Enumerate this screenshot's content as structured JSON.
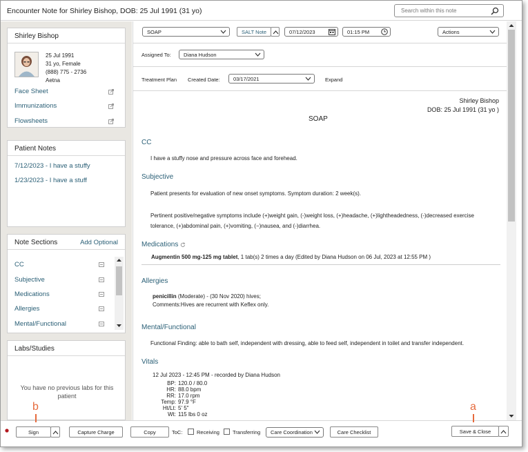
{
  "window": {
    "title": "Encounter Note for Shirley Bishop, DOB: 25 Jul 1991 (31 yo)"
  },
  "search": {
    "placeholder": "Search within this note"
  },
  "patient": {
    "name": "Shirley Bishop",
    "dob": "25 Jul 1991",
    "age_sex": "31 yo, Female",
    "phone": "(888) 775 - 2736",
    "insurance": "Aetna",
    "links": [
      "Face Sheet",
      "Immunizations",
      "Flowsheets"
    ]
  },
  "patient_notes": {
    "title": "Patient Notes",
    "items": [
      "7/12/2023 - I have a stuffy",
      "1/23/2023 - I have a stuff"
    ]
  },
  "note_sections": {
    "title": "Note Sections",
    "add_label": "Add Optional",
    "items": [
      "CC",
      "Subjective",
      "Medications",
      "Allergies",
      "Mental/Functional"
    ]
  },
  "labs": {
    "title": "Labs/Studies",
    "empty_text": "You have no previous labs for this patient"
  },
  "toolbar": {
    "template": "SOAP",
    "salt_note": "SALT Note",
    "date": "07/12/2023",
    "time": "01:15 PM",
    "actions": "Actions"
  },
  "assigned": {
    "label": "Assigned To:",
    "value": "Diana Hudson"
  },
  "treatment": {
    "label": "Treatment Plan",
    "created_label": "Created Date:",
    "created_value": "03/17/2021",
    "expand": "Expand"
  },
  "document": {
    "patient_name": "Shirley Bishop",
    "patient_dob": "DOB: 25 Jul 1991 (31 yo )",
    "heading": "SOAP",
    "cc_title": "CC",
    "cc_text": "I have a stuffy nose and pressure across face and forehead.",
    "subjective_title": "Subjective",
    "subjective_text1": "Patient presents for evaluation of new onset symptoms. Symptom duration: 2 week(s).",
    "subjective_text2": "Pertinent positive/negative symptoms include (+)weight gain, (-)weight loss, (+)headache, (+)lightheadedness, (-)decreased exercise",
    "subjective_text3": "tolerance, (+)abdominal pain, (+)vomiting, (−)nausea, and (-)diarrhea.",
    "medications_title": "Medications",
    "medication_name": "Augmentin 500 mg-125 mg tablet",
    "medication_detail": ", 1 tab(s) 2 times a day (Edited by Diana Hudson on 06 Jul, 2023 at 12:55 PM )",
    "allergies_title": "Allergies",
    "allergy_name": "penicillin",
    "allergy_detail": " (Moderate) - (30 Nov 2020) hives;",
    "allergy_comments": "Comments:Hives are recurrent with Keflex only.",
    "mental_title": "Mental/Functional",
    "mental_text": "Functional Finding: able to bath self, independent with dressing, able to feed self, independent in toilet and transfer independent.",
    "vitals_title": "Vitals",
    "vitals_header": "12 Jul 2023 - 12:45 PM - recorded by Diana Hudson",
    "vitals": [
      {
        "label": "BP:",
        "value": "120.0 / 80.0"
      },
      {
        "label": "HR:",
        "value": "88.0 bpm"
      },
      {
        "label": "RR:",
        "value": "17.0 rpm"
      },
      {
        "label": "Temp:",
        "value": "97.9 °F"
      },
      {
        "label": "Ht/Lt:",
        "value": "5' 5\""
      },
      {
        "label": "Wt:",
        "value": "115 lbs 0 oz"
      }
    ]
  },
  "bottom": {
    "sign": "Sign",
    "capture_charge": "Capture Charge",
    "copy": "Copy",
    "toc_label": "ToC:",
    "receiving": "Receiving",
    "transferring": "Transferring",
    "care_coordination": "Care Coordination",
    "care_checklist": "Care Checklist",
    "save_close": "Save & Close"
  },
  "callouts": {
    "a": "a",
    "b": "b"
  },
  "colors": {
    "link": "#2a5f76",
    "callout": "#e66a3c",
    "sidebar_bg": "#e9e7e2"
  }
}
